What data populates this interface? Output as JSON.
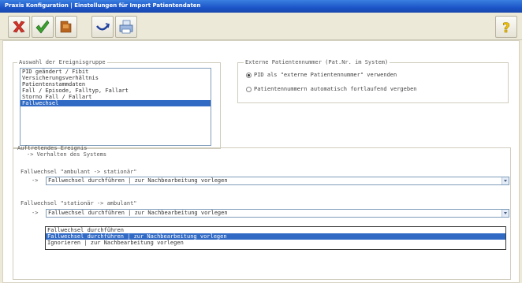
{
  "window": {
    "title": "Praxis Konfiguration | Einstellungen für Import Patientendaten"
  },
  "toolbar": {
    "buttons": [
      {
        "name": "delete-button",
        "icon": "x-icon"
      },
      {
        "name": "ok-button",
        "icon": "checkmark-icon"
      },
      {
        "name": "folder-button",
        "icon": "folder-icon"
      },
      {
        "name": "undo-button",
        "icon": "undo-icon"
      },
      {
        "name": "print-button",
        "icon": "printer-icon"
      },
      {
        "name": "help-button",
        "icon": "help-icon"
      }
    ]
  },
  "event_group": {
    "legend": "Auswahl der Ereignisgruppe",
    "items": [
      "PID geändert / Fibit",
      "Versicherungsverhältnis",
      "Patientenstammdaten",
      "Fall / Episode, Falltyp, Fallart",
      "Storno Fall / Fallart",
      "Fallwechsel"
    ],
    "selected_index": 5
  },
  "external_pid": {
    "legend": "Externe Patientennummer (Pat.Nr. im System)",
    "options": [
      {
        "label": "PID als \"externe Patientennummer\" verwenden",
        "checked": true
      },
      {
        "label": "Patientennummern automatisch fortlaufend vergeben",
        "checked": false
      }
    ]
  },
  "occurring_event": {
    "legend": "Auftretendes Ereignis",
    "sublegend": "-> Verhalten des Systems",
    "rule1": {
      "label": "Fallwechsel \"ambulant -> stationär\"",
      "arrow": "->",
      "value": "Fallwechsel durchführen | zur Nachbearbeitung vorlegen"
    },
    "rule2": {
      "label": "Fallwechsel \"stationär -> ambulant\"",
      "arrow": "->",
      "value": "Fallwechsel durchführen | zur Nachbearbeitung vorlegen"
    },
    "dropdown_options": [
      "Fallwechsel durchführen",
      "Fallwechsel durchführen | zur Nachbearbeitung vorlegen",
      "Ignorieren | zur Nachbearbeitung vorlegen"
    ],
    "dropdown_selected_index": 1
  }
}
